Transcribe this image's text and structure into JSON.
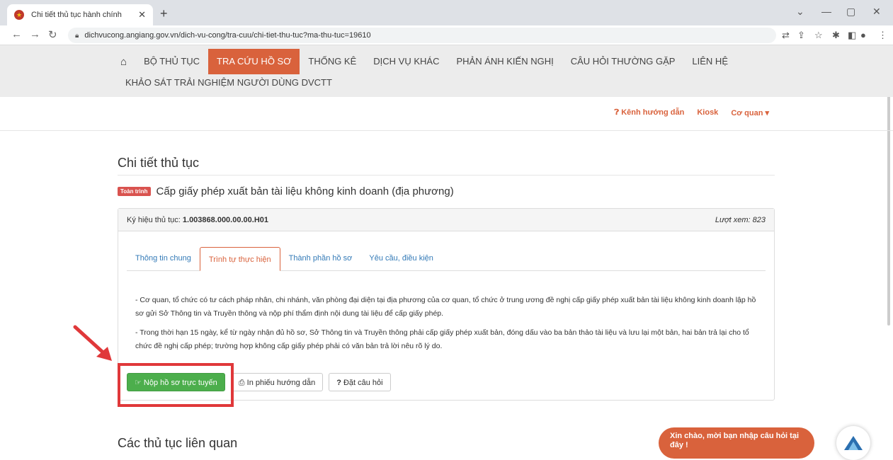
{
  "browser": {
    "tab_title": "Chi tiết thủ tục hành chính",
    "url": "dichvucong.angiang.gov.vn/dich-vu-cong/tra-cuu/chi-tiet-thu-tuc?ma-thu-tuc=19610"
  },
  "nav": {
    "items": [
      "BỘ THỦ TỤC",
      "TRA CỨU HỒ SƠ",
      "THỐNG KÊ",
      "DỊCH VỤ KHÁC",
      "PHẢN ÁNH KIẾN NGHỊ",
      "CÂU HỎI THƯỜNG GẶP",
      "LIÊN HỆ"
    ],
    "row2": "KHẢO SÁT TRẢI NGHIỆM NGƯỜI DÙNG DVCTT"
  },
  "subnav": {
    "guide": "Kênh hướng dẫn",
    "kiosk": "Kiosk",
    "agency": "Cơ quan"
  },
  "main": {
    "page_title": "Chi tiết thủ tục",
    "badge": "Toàn trình",
    "proc_name": "Cấp giấy phép xuất bản tài liệu không kinh doanh (địa phương)",
    "code_label": "Ký hiệu thủ tục:",
    "code_value": "1.003868.000.00.00.H01",
    "views": "Lượt xem: 823",
    "tabs": [
      "Thông tin chung",
      "Trình tự thực hiện",
      "Thành phần hồ sơ",
      "Yêu cầu, điều kiện"
    ],
    "para1": "- Cơ quan, tổ chức có tư cách pháp nhân, chi nhánh, văn phòng đại diện tại địa phương của cơ quan, tổ chức ở trung ương đề nghị cấp giấy phép xuất bản tài liệu không kinh doanh lập hồ sơ gửi Sở Thông tin và Truyền thông và nộp phí thẩm định nội dung tài liệu để cấp giấy phép.",
    "para2": "- Trong thời hạn 15 ngày, kể từ ngày nhận đủ hồ sơ, Sở Thông tin và Truyền thông phải cấp giấy phép xuất bản, đóng dấu vào ba bản thảo tài liệu và lưu lại một bản, hai bản trả lại cho tổ chức đề nghị cấp phép; trường hợp không cấp giấy phép phải có văn bản trả lời nêu rõ lý do.",
    "btn_submit": "Nộp hồ sơ trực tuyến",
    "btn_print": "In phiếu hướng dẫn",
    "btn_ask": "Đặt câu hỏi",
    "related_title": "Các thủ tục liên quan"
  },
  "chat": {
    "greeting": "Xin chào, mời bạn nhập câu hỏi tại đây !"
  }
}
